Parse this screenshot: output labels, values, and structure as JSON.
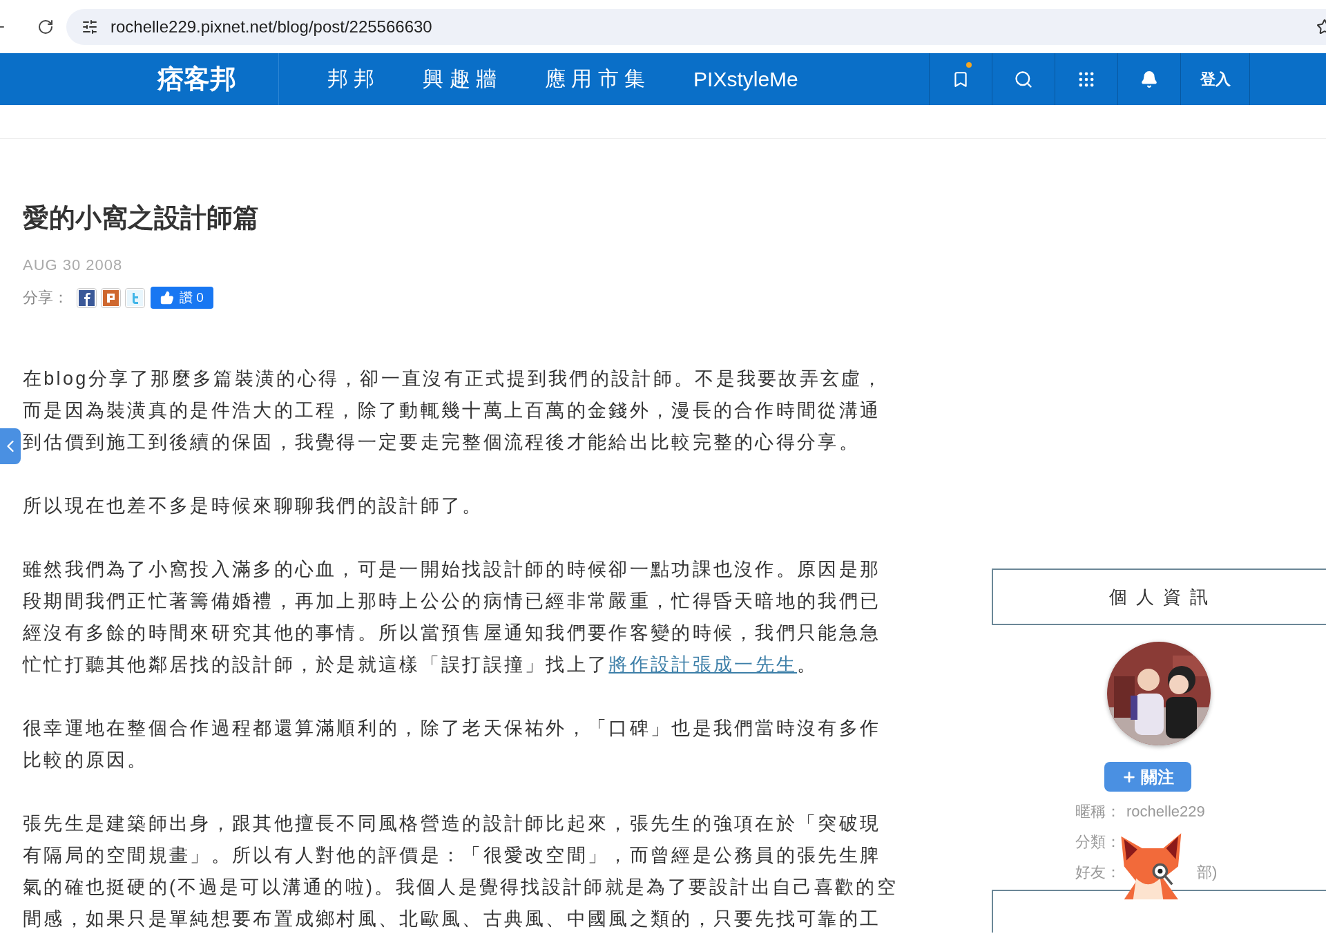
{
  "browser": {
    "url": "rochelle229.pixnet.net/blog/post/225566630"
  },
  "nav": {
    "logo": "痞客邦",
    "items": [
      {
        "label": "邦 邦"
      },
      {
        "label": "興 趣 牆"
      },
      {
        "label": "應 用 市 集"
      },
      {
        "label": "PIXstyleMe"
      }
    ],
    "tools": [
      {
        "kind": "bookmark",
        "dot": true
      },
      {
        "kind": "search",
        "dot": false
      },
      {
        "kind": "apps",
        "dot": false
      },
      {
        "kind": "bell",
        "dot": false
      }
    ],
    "login": "登入"
  },
  "post": {
    "title": "愛的小窩之設計師篇",
    "date": "AUG 30 2008",
    "share_label": "分享：",
    "share_buttons": [
      {
        "kind": "facebook"
      },
      {
        "kind": "plurk"
      },
      {
        "kind": "twitter"
      }
    ],
    "like": "讚 0",
    "paragraphs": [
      {
        "lines": [
          "在blog分享了那麼多篇裝潢的心得，卻一直沒有正式提到我們的設計師。不是我要故弄玄虛，",
          "而是因為裝潢真的是件浩大的工程，除了動輒幾十萬上百萬的金錢外，漫長的合作時間從溝通",
          "到估價到施工到後續的保固，我覺得一定要走完整個流程後才能給出比較完整的心得分享。"
        ]
      },
      {
        "lines": [
          "所以現在也差不多是時候來聊聊我們的設計師了。"
        ]
      },
      {
        "lines": [
          "雖然我們為了小窩投入滿多的心血，可是一開始找設計師的時候卻一點功課也沒作。原因是那",
          "段期間我們正忙著籌備婚禮，再加上那時上公公的病情已經非常嚴重，忙得昏天暗地的我們已",
          "經沒有多餘的時間來研究其他的事情。所以當預售屋通知我們要作客變的時候，我們只能急急",
          "忙忙打聽其他鄰居找的設計師，於是就這樣「誤打誤撞」找上了"
        ],
        "link": {
          "text": "將作設計張成一先生",
          "after": "。"
        }
      },
      {
        "lines": [
          "很幸運地在整個合作過程都還算滿順利的，除了老天保祐外，「口碑」也是我們當時沒有多作",
          "比較的原因。"
        ]
      },
      {
        "lines": [
          "張先生是建築師出身，跟其他擅長不同風格營造的設計師比起來，張先生的強項在於「突破現",
          "有隔局的空間規畫」。所以有人對他的評價是：「很愛改空間」，而曾經是公務員的張先生脾",
          "氣的確也挺硬的(不過是可以溝通的啦)。我個人是覺得找設計師就是為了要設計出自己喜歡的空",
          "間感，如果只是單純想要布置成鄉村風、北歐風、古典風、中國風之類的，只要先找可靠的工"
        ]
      }
    ]
  },
  "sidebar": {
    "heading": "個 人 資 訊",
    "follow": "關注",
    "info": [
      {
        "label": "暱稱：",
        "value": "rochelle229"
      },
      {
        "label": "分類："
      },
      {
        "label": "好友：",
        "value": "部)"
      }
    ]
  }
}
